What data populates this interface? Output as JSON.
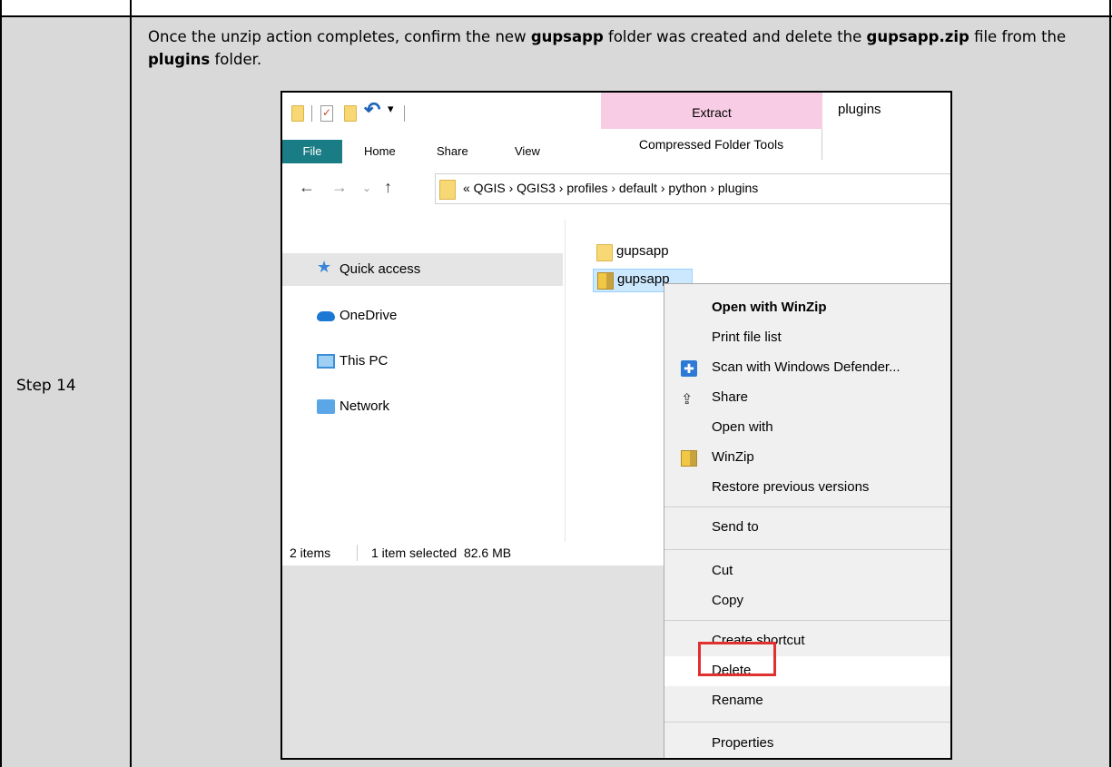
{
  "document": {
    "step_label": "Step 14",
    "instruction_parts": [
      "Once the unzip action completes, confirm the new ",
      "gupsapp",
      " folder was created and delete the ",
      "gupsapp.zip",
      " file from the ",
      "plugins",
      " folder."
    ]
  },
  "explorer": {
    "contextual_tab": "Extract",
    "contextual_group": "Compressed Folder Tools",
    "window_title": "plugins",
    "tabs": [
      "File",
      "Home",
      "Share",
      "View"
    ],
    "breadcrumb": "« QGIS › QGIS3 › profiles › default › python › plugins",
    "nav_items": [
      "Quick access",
      "OneDrive",
      "This PC",
      "Network"
    ],
    "files": [
      {
        "name": "gupsapp",
        "type": "folder"
      },
      {
        "name": "gupsapp",
        "type": "zip"
      }
    ],
    "status": {
      "count": "2 items",
      "selection": "1 item selected  82.6 MB"
    }
  },
  "context_menu": {
    "items": [
      {
        "label": "Open with WinZip",
        "icon": ""
      },
      {
        "label": "Print file list",
        "icon": ""
      },
      {
        "label": "Scan with Windows Defender...",
        "icon": "shield-icon"
      },
      {
        "label": "Share",
        "icon": "share-icon"
      },
      {
        "label": "Open with",
        "icon": ""
      },
      {
        "label": "WinZip",
        "icon": "winzip-icon"
      },
      {
        "label": "Restore previous versions",
        "icon": ""
      },
      {
        "label": "Send to",
        "icon": ""
      },
      {
        "label": "Cut",
        "icon": ""
      },
      {
        "label": "Copy",
        "icon": ""
      },
      {
        "label": "Create shortcut",
        "icon": ""
      },
      {
        "label": "Delete",
        "icon": ""
      },
      {
        "label": "Rename",
        "icon": ""
      },
      {
        "label": "Properties",
        "icon": ""
      }
    ],
    "highlight_color": "#e03030"
  }
}
